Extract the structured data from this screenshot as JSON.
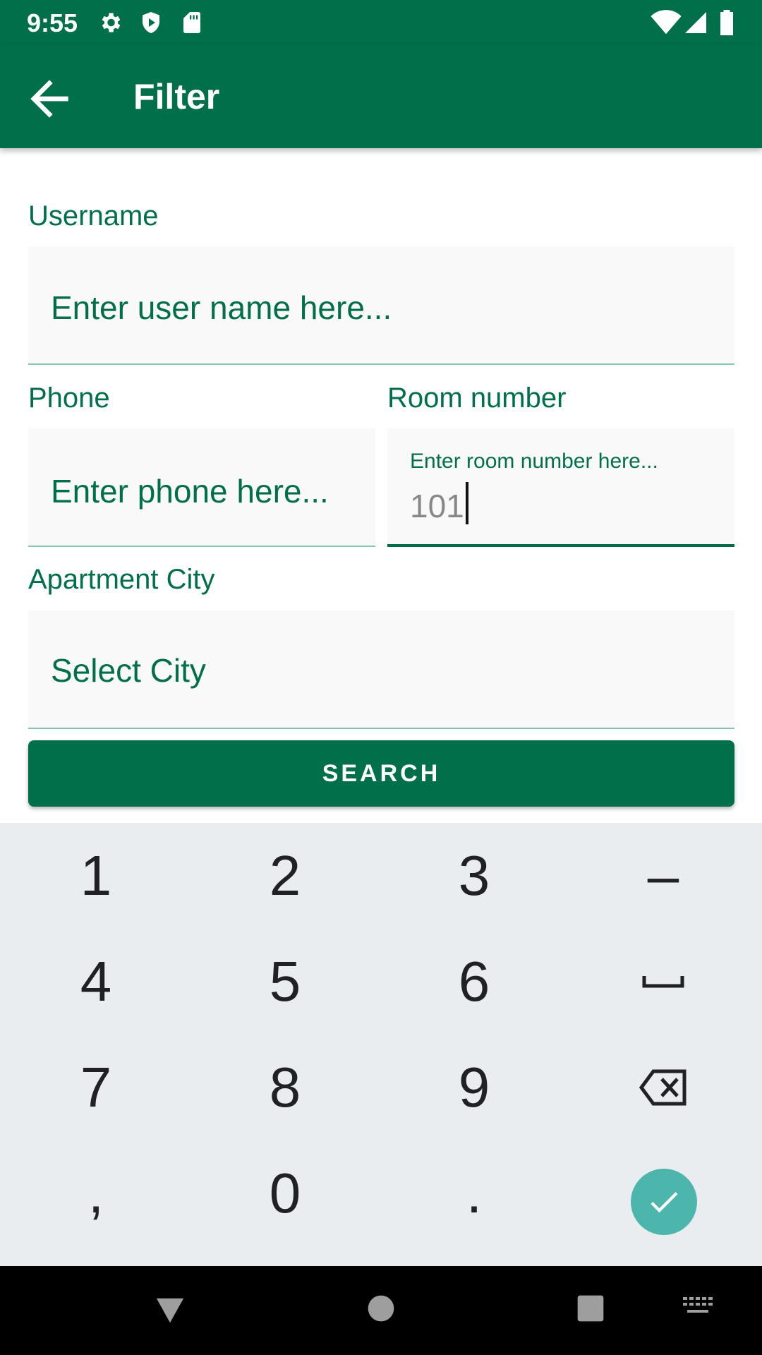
{
  "status_bar": {
    "time": "9:55",
    "left_icons": [
      "gear-icon",
      "shield-play-icon",
      "sd-card-icon"
    ],
    "right_icons": [
      "wifi-icon",
      "signal-icon",
      "battery-icon"
    ]
  },
  "app_bar": {
    "back_icon": "arrow-left-icon",
    "title": "Filter"
  },
  "form": {
    "username": {
      "label": "Username",
      "placeholder": "Enter user name here..."
    },
    "phone": {
      "label": "Phone",
      "placeholder": "Enter phone here..."
    },
    "room": {
      "label": "Room number",
      "hint": "Enter room number here...",
      "value": "101"
    },
    "city": {
      "label": "Apartment City",
      "placeholder": "Select City"
    },
    "search_label": "SEARCH"
  },
  "keyboard": {
    "keys": [
      "1",
      "2",
      "3",
      "–",
      "4",
      "5",
      "6",
      "␣",
      "7",
      "8",
      "9",
      "backspace",
      ",",
      "0",
      ".",
      "done"
    ],
    "done_icon": "check-icon",
    "backspace_icon": "backspace-icon",
    "space_icon": "space-icon"
  },
  "nav_bar": {
    "items": [
      "back-triangle-icon",
      "home-circle-icon",
      "recents-square-icon",
      "keyboard-switch-icon"
    ]
  },
  "colors": {
    "primary": "#016f4a",
    "field_bg": "#f9f9f9",
    "field_line": "#86c5b1",
    "keyboard_bg": "#e9edf0",
    "done_key": "#4db6ac"
  }
}
